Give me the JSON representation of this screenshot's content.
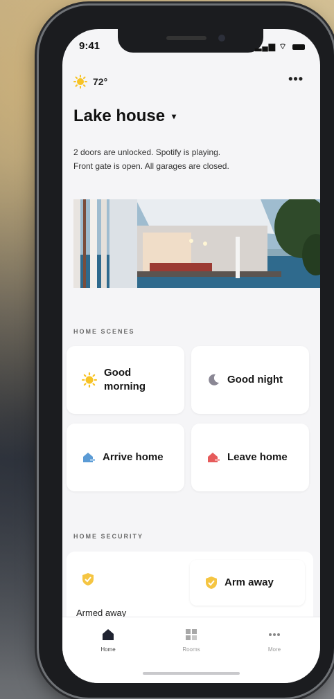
{
  "status_bar": {
    "time": "9:41",
    "signal_icon": "signal-icon",
    "wifi_icon": "wifi-icon",
    "battery_icon": "battery-icon"
  },
  "weather": {
    "temp": "72°",
    "icon": "sun-icon"
  },
  "menu": {
    "more_label": "•••"
  },
  "home": {
    "title": "Lake house",
    "caret": "▾"
  },
  "summary": {
    "line1": "2 doors are unlocked. Spotify is playing.",
    "line2": "Front gate is open. All garages are closed."
  },
  "scenes": {
    "label": "HOME SCENES",
    "items": [
      {
        "label_line1": "Good",
        "label_line2": "morning",
        "icon": "sun-icon"
      },
      {
        "label": "Good night",
        "icon": "moon-icon"
      },
      {
        "label": "Arrive home",
        "icon": "arrive-home-icon"
      },
      {
        "label": "Leave home",
        "icon": "leave-home-icon"
      }
    ]
  },
  "security": {
    "label": "HOME SECURITY",
    "status": "Armed away",
    "arm_away_label": "Arm away",
    "icon": "shield-icon"
  },
  "tabs": [
    {
      "label": "Home",
      "icon": "home-icon"
    },
    {
      "label": "Rooms",
      "icon": "rooms-icon"
    },
    {
      "label": "More",
      "icon": "more-icon"
    }
  ],
  "colors": {
    "sun": "#f7c325",
    "shield": "#f5c542",
    "arrive": "#5b9bd5",
    "leave": "#e65b5b",
    "moon": "#8a8794"
  }
}
